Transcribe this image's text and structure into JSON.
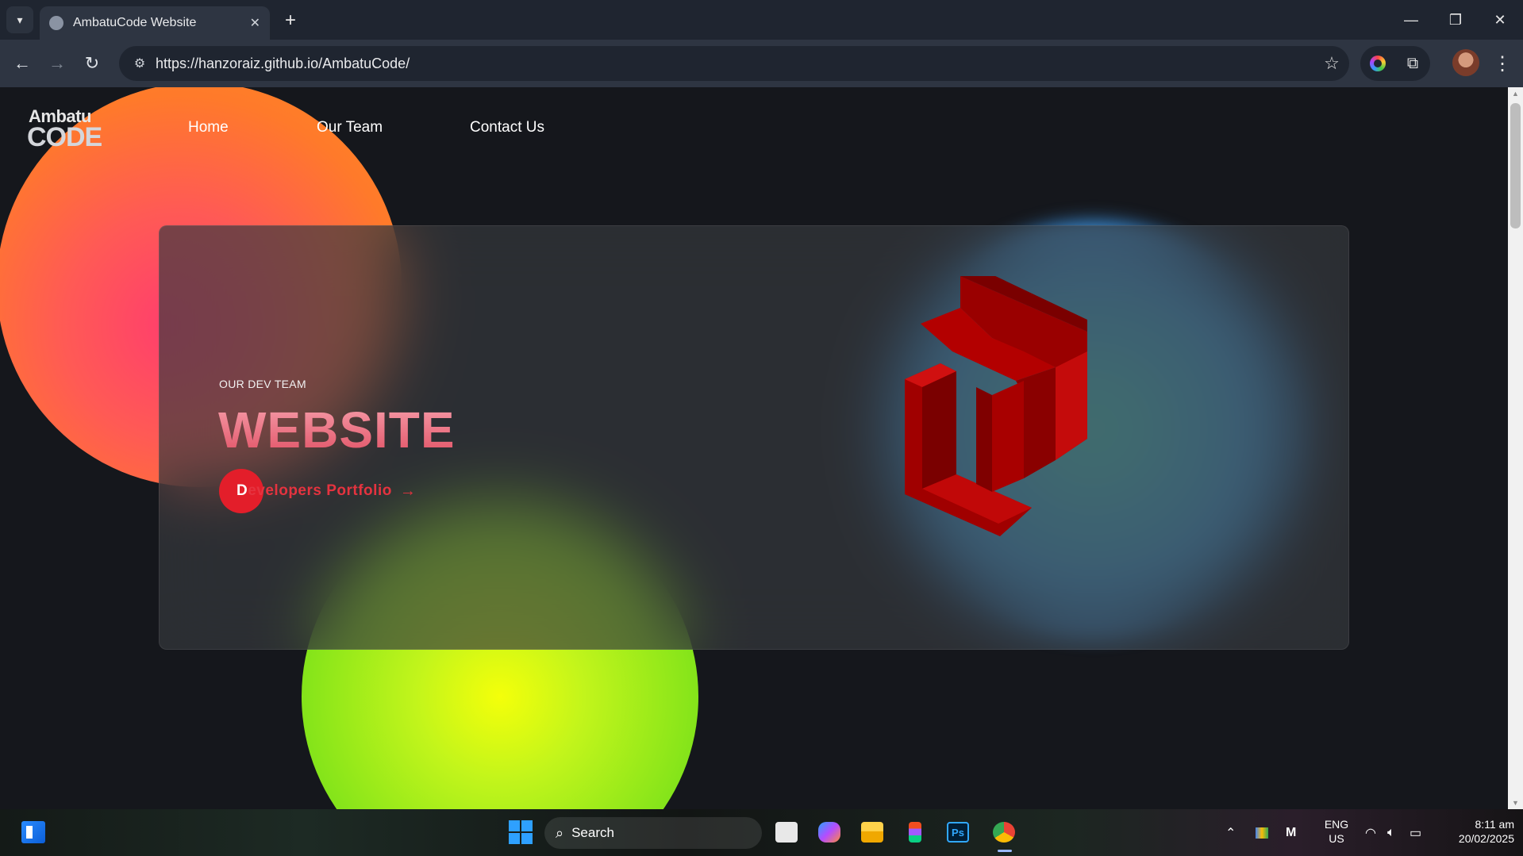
{
  "browser": {
    "tab_title": "AmbatuCode Website",
    "tab_close": "✕",
    "new_tab": "+",
    "url": "https://hanzoraiz.github.io/AmbatuCode/",
    "window_controls": {
      "minimize": "—",
      "restore": "❐",
      "close": "✕"
    }
  },
  "site": {
    "logo": {
      "line1": "Ambatu",
      "line2": "CODE"
    },
    "nav": {
      "home": "Home",
      "team": "Our Team",
      "contact": "Contact Us"
    },
    "hero": {
      "kicker": "OUR DEV TEAM",
      "title": "WEBSITE",
      "cta_label": "Developers Portfolio",
      "cta_arrow": "→"
    },
    "colors": {
      "brand_red": "#e31e2a",
      "mark_red": "#b00000",
      "blob_orange": "#ff7a2a",
      "blob_green": "#a4ee14",
      "blob_blue": "#3a8ae6"
    }
  },
  "taskbar": {
    "search_placeholder": "Search",
    "language_line1": "ENG",
    "language_line2": "US",
    "time": "8:11 am",
    "date": "20/02/2025"
  }
}
